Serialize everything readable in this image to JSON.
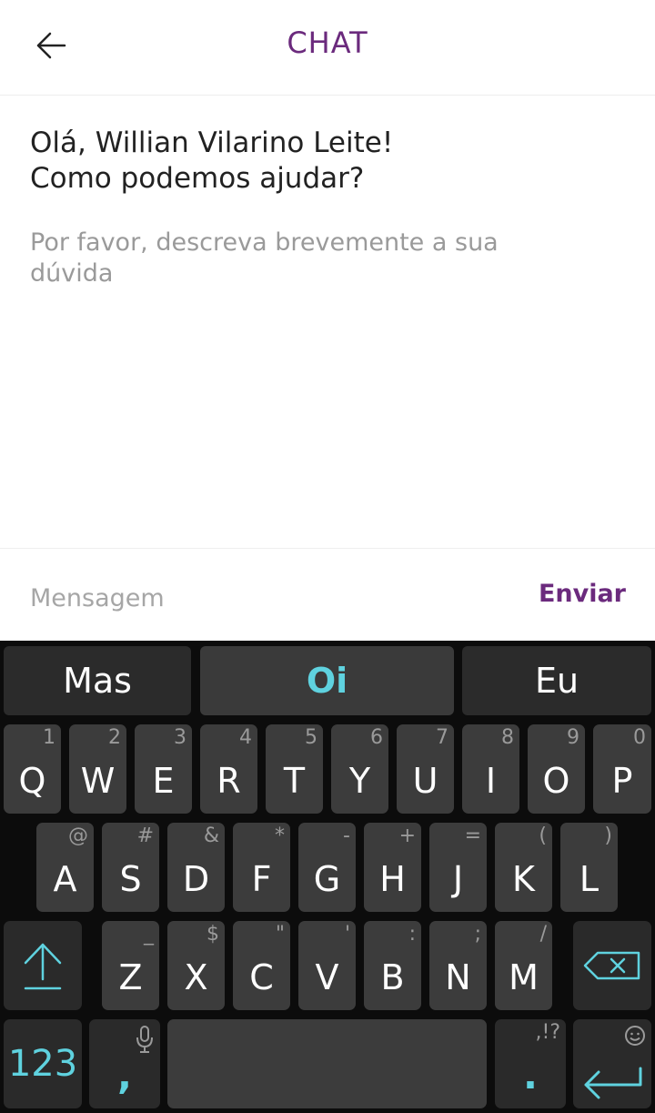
{
  "header": {
    "title": "CHAT",
    "back_icon": "arrow-left-icon"
  },
  "content": {
    "greeting_line1": "Olá, Willian Vilarino Leite!",
    "greeting_line2": "Como podemos ajudar?",
    "hint": "Por favor, descreva brevemente a sua dúvida"
  },
  "message_bar": {
    "placeholder": "Mensagem",
    "value": "",
    "send_label": "Enviar"
  },
  "keyboard": {
    "suggestions": [
      "Mas",
      "Oi",
      "Eu"
    ],
    "row1": [
      {
        "label": "Q",
        "sub": "1"
      },
      {
        "label": "W",
        "sub": "2"
      },
      {
        "label": "E",
        "sub": "3"
      },
      {
        "label": "R",
        "sub": "4"
      },
      {
        "label": "T",
        "sub": "5"
      },
      {
        "label": "Y",
        "sub": "6"
      },
      {
        "label": "U",
        "sub": "7"
      },
      {
        "label": "I",
        "sub": "8"
      },
      {
        "label": "O",
        "sub": "9"
      },
      {
        "label": "P",
        "sub": "0"
      }
    ],
    "row2": [
      {
        "label": "A",
        "sub": "@"
      },
      {
        "label": "S",
        "sub": "#"
      },
      {
        "label": "D",
        "sub": "&"
      },
      {
        "label": "F",
        "sub": "*"
      },
      {
        "label": "G",
        "sub": "-"
      },
      {
        "label": "H",
        "sub": "+"
      },
      {
        "label": "J",
        "sub": "="
      },
      {
        "label": "K",
        "sub": "("
      },
      {
        "label": "L",
        "sub": ")"
      }
    ],
    "row3": [
      {
        "label": "Z",
        "sub": "_"
      },
      {
        "label": "X",
        "sub": "$"
      },
      {
        "label": "C",
        "sub": "\""
      },
      {
        "label": "V",
        "sub": "'"
      },
      {
        "label": "B",
        "sub": ":"
      },
      {
        "label": "N",
        "sub": ";"
      },
      {
        "label": "M",
        "sub": "/"
      }
    ],
    "numbers_label": "123",
    "comma_label": ",",
    "period_label": ".",
    "punct_hint": ",!?",
    "accent_color": "#5fd2df"
  },
  "colors": {
    "brand": "#6b2a7d",
    "keyboard_bg": "#0c0c0c",
    "key_bg": "#3c3c3c"
  }
}
